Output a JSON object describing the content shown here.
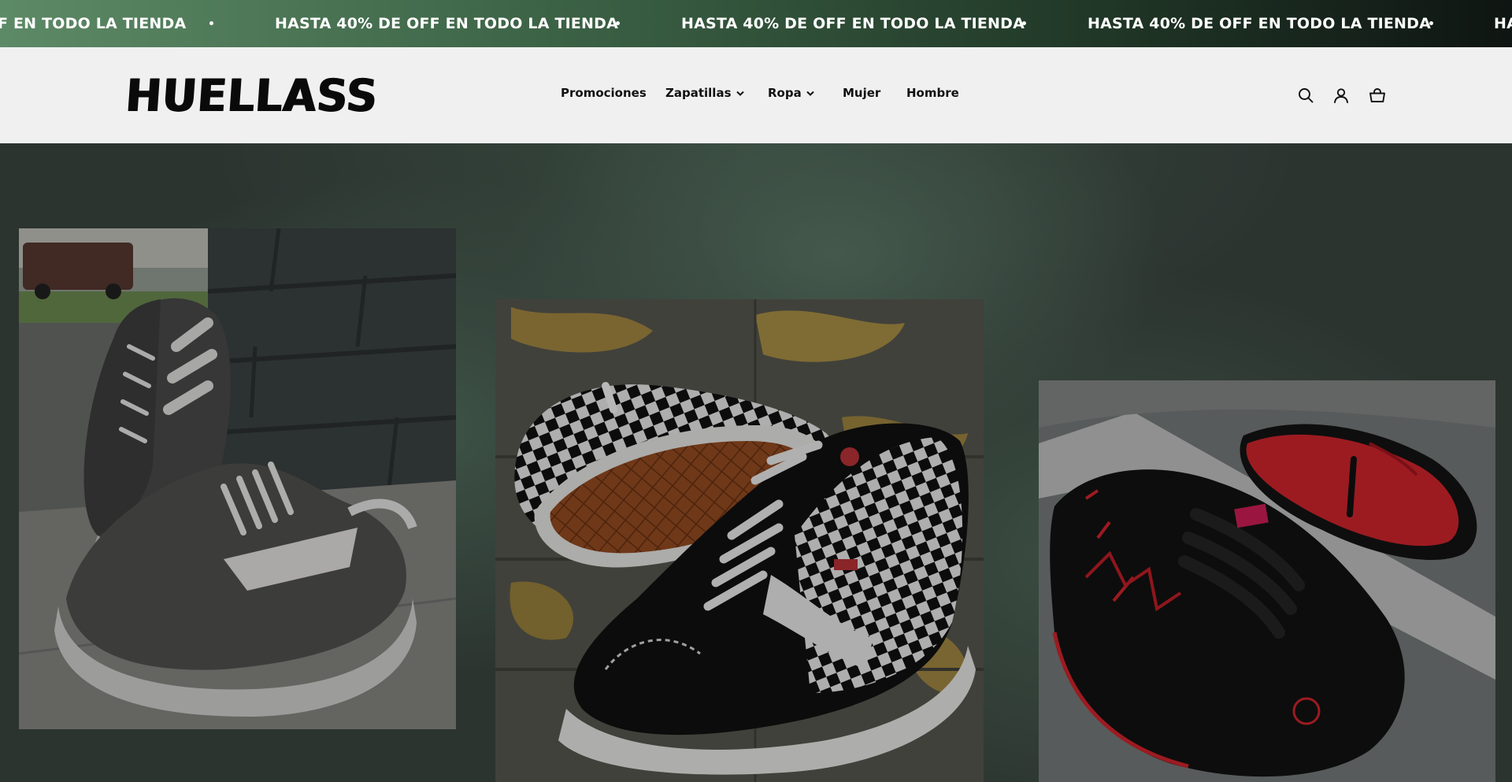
{
  "announcement": {
    "text": "HASTA 40% DE OFF EN TODO LA TIENDA",
    "first_visible_fragment": "F EN TODO LA TIENDA",
    "last_visible_fragment": "HA"
  },
  "header": {
    "logo_text": "HUELLASS",
    "nav": [
      {
        "label": "Promociones",
        "has_dropdown": false
      },
      {
        "label": "Zapatillas",
        "has_dropdown": true
      },
      {
        "label": "Ropa",
        "has_dropdown": true
      },
      {
        "label": "Mujer",
        "has_dropdown": false
      },
      {
        "label": "Hombre",
        "has_dropdown": false
      }
    ],
    "icons": [
      "search-icon",
      "account-icon",
      "cart-icon"
    ]
  },
  "hero": {
    "images": [
      {
        "subject": "gray-sneakers-photo"
      },
      {
        "subject": "checkerboard-hightop-photo"
      },
      {
        "subject": "black-red-skate-shoes-photo"
      }
    ]
  },
  "colors": {
    "announcement_start": "#5d8a66",
    "announcement_end": "#0f1512",
    "header_bg": "#f0f0f0",
    "hero_bg": "#2c3430"
  }
}
